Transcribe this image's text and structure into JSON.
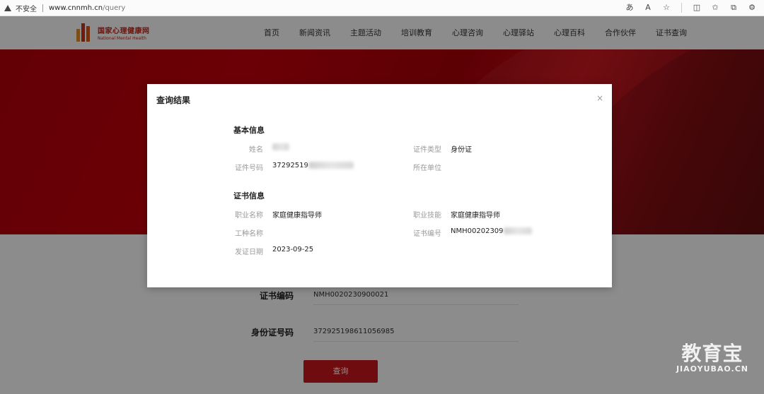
{
  "browser": {
    "insecure_label": "不安全",
    "url_domain": "www.cnnmh.cn",
    "url_path": "/query"
  },
  "site": {
    "logo_cn": "国家心理健康网",
    "logo_en": "National Mental Health",
    "nav": [
      "首页",
      "新闻资讯",
      "主题活动",
      "培训教育",
      "心理咨询",
      "心理驿站",
      "心理百科",
      "合作伙伴",
      "证书查询"
    ]
  },
  "form": {
    "cert_no_label": "证书编码",
    "cert_no_value": "NMH0020230900021",
    "id_no_label": "身份证号码",
    "id_no_value": "372925198611056985",
    "query_button": "查询"
  },
  "modal": {
    "title": "查询结果",
    "close": "×",
    "basic_section": "基本信息",
    "name_label": "姓名",
    "id_type_label": "证件类型",
    "id_type_value": "身份证",
    "id_no_label": "证件号码",
    "id_no_value": "37292519",
    "unit_label": "所在单位",
    "cert_section": "证书信息",
    "job_label": "职业名称",
    "job_value": "家庭健康指导师",
    "skill_label": "职业技能",
    "skill_value": "家庭健康指导师",
    "work_type_label": "工种名称",
    "cert_no_label": "证书编号",
    "cert_no_value": "NMH00202309",
    "issue_date_label": "发证日期",
    "issue_date_value": "2023-09-25"
  },
  "watermark": {
    "cn": "教育宝",
    "en": "JIAOYUBAO.CN"
  }
}
